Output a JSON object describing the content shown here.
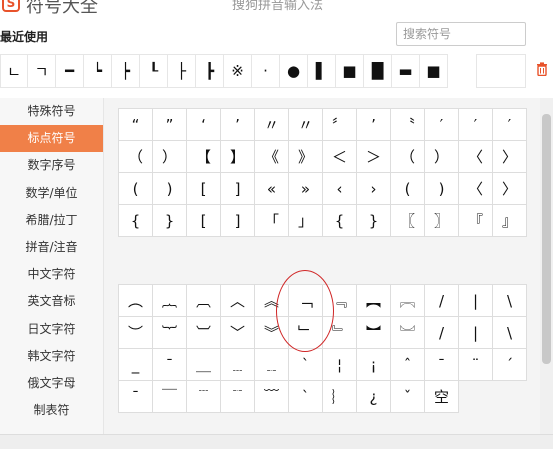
{
  "app": {
    "title": "符号大全",
    "subtitle": "搜狗拼音输入法",
    "logo": "S"
  },
  "recent": {
    "label": "最近使用",
    "symbols": [
      "ㄴ",
      "ㄱ",
      "━",
      "┕",
      "┝",
      "┖",
      "├",
      "┣",
      "※",
      "·",
      "●",
      "▌",
      "■",
      "█",
      "▬",
      "■"
    ]
  },
  "search": {
    "placeholder": "搜索符号"
  },
  "sidebar": {
    "items": [
      {
        "label": "特殊符号",
        "active": false
      },
      {
        "label": "标点符号",
        "active": true
      },
      {
        "label": "数字序号",
        "active": false
      },
      {
        "label": "数学/单位",
        "active": false
      },
      {
        "label": "希腊/拉丁",
        "active": false
      },
      {
        "label": "拼音/注音",
        "active": false
      },
      {
        "label": "中文字符",
        "active": false
      },
      {
        "label": "英文音标",
        "active": false
      },
      {
        "label": "日文字符",
        "active": false
      },
      {
        "label": "韩文字符",
        "active": false
      },
      {
        "label": "俄文字母",
        "active": false
      },
      {
        "label": "制表符",
        "active": false
      }
    ]
  },
  "symbol_grid_1": [
    "“",
    "”",
    "‘",
    "’",
    "〃",
    "〃",
    "〞",
    "’",
    "〝",
    "′",
    "′",
    "′",
    "（",
    "）",
    "【",
    "】",
    "《",
    "》",
    "＜",
    "＞",
    "（",
    "）",
    "〈",
    "〉",
    "(",
    ")",
    "[",
    "]",
    "«",
    "»",
    "‹",
    "›",
    "(",
    ")",
    "〈",
    "〉",
    "{",
    "}",
    "[",
    "]",
    "「",
    "」",
    "{",
    "}",
    "〖",
    "〗",
    "『",
    "』"
  ],
  "symbol_grid_2": [
    "︵",
    "︷",
    "︹",
    "︿",
    "︽",
    "﹁",
    "﹃",
    "︻",
    "︗",
    "/",
    "|",
    "\\",
    "︶",
    "︸",
    "︺",
    "﹀",
    "︾",
    "﹂",
    "﹄",
    "︼",
    "︘",
    "/",
    "|",
    "\\",
    "_",
    "¯",
    "＿",
    "﹍",
    "﹎",
    "ˋ",
    "¦",
    "¡",
    "ˆ",
    "ˉ",
    "¨",
    "ˊ",
    "ˉ",
    "￣",
    "﹉",
    "﹊",
    "﹋",
    "ˋ",
    "︴",
    "¿",
    "ˇ",
    "空",
    "",
    ""
  ],
  "colors": {
    "accent": "#f08048",
    "annotation": "#d02626"
  }
}
